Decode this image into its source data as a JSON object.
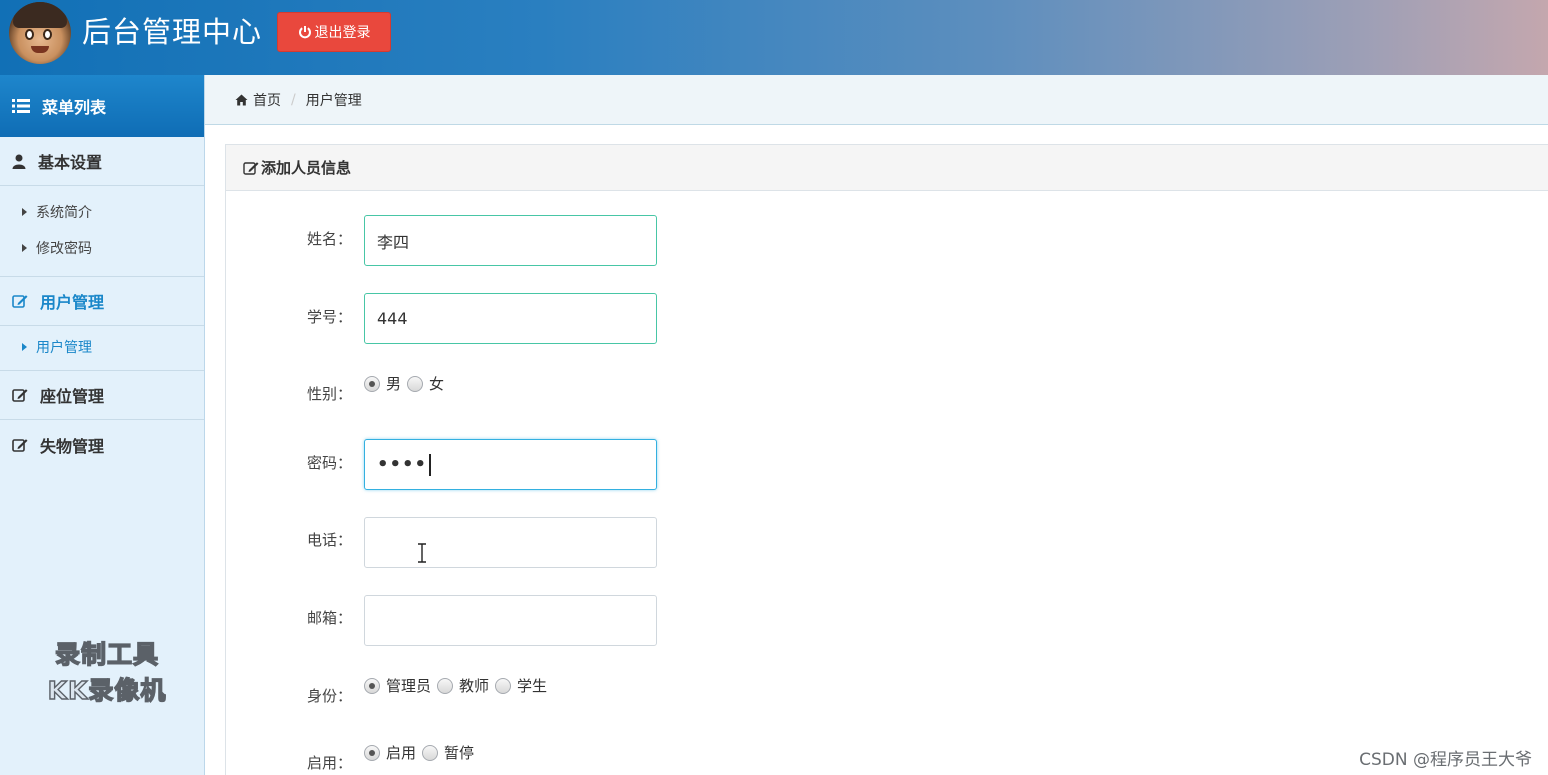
{
  "header": {
    "title": "后台管理中心",
    "logout_label": "退出登录"
  },
  "sidebar": {
    "menu_title": "菜单列表",
    "groups": [
      {
        "label": "基本设置",
        "icon": "user-icon",
        "items": [
          "系统简介",
          "修改密码"
        ]
      },
      {
        "label": "用户管理",
        "icon": "edit-icon",
        "active": true,
        "items": [
          "用户管理"
        ]
      },
      {
        "label": "座位管理",
        "icon": "edit-icon"
      },
      {
        "label": "失物管理",
        "icon": "edit-icon"
      }
    ],
    "watermark": [
      "录制工具",
      "KK录像机"
    ]
  },
  "breadcrumb": {
    "home": "首页",
    "current": "用户管理"
  },
  "panel": {
    "title": "添加人员信息"
  },
  "form": {
    "name_label": "姓名：",
    "name_value": "李四",
    "id_label": "学号：",
    "id_value": "444",
    "gender_label": "性别：",
    "gender_options": [
      "男",
      "女"
    ],
    "gender_selected": "男",
    "password_label": "密码：",
    "password_mask": "••••",
    "phone_label": "电话：",
    "phone_value": "",
    "email_label": "邮箱：",
    "email_value": "",
    "role_label": "身份：",
    "role_options": [
      "管理员",
      "教师",
      "学生"
    ],
    "role_selected": "管理员",
    "status_label": "启用：",
    "status_options": [
      "启用",
      "暂停"
    ],
    "status_selected": "启用"
  },
  "footer": {
    "credit": "CSDN @程序员王大爷"
  },
  "colors": {
    "header_blue": "#1170b6",
    "logout_red": "#e9483d",
    "active_blue": "#1a87c9",
    "sidebar_bg": "#e3f1fb"
  }
}
